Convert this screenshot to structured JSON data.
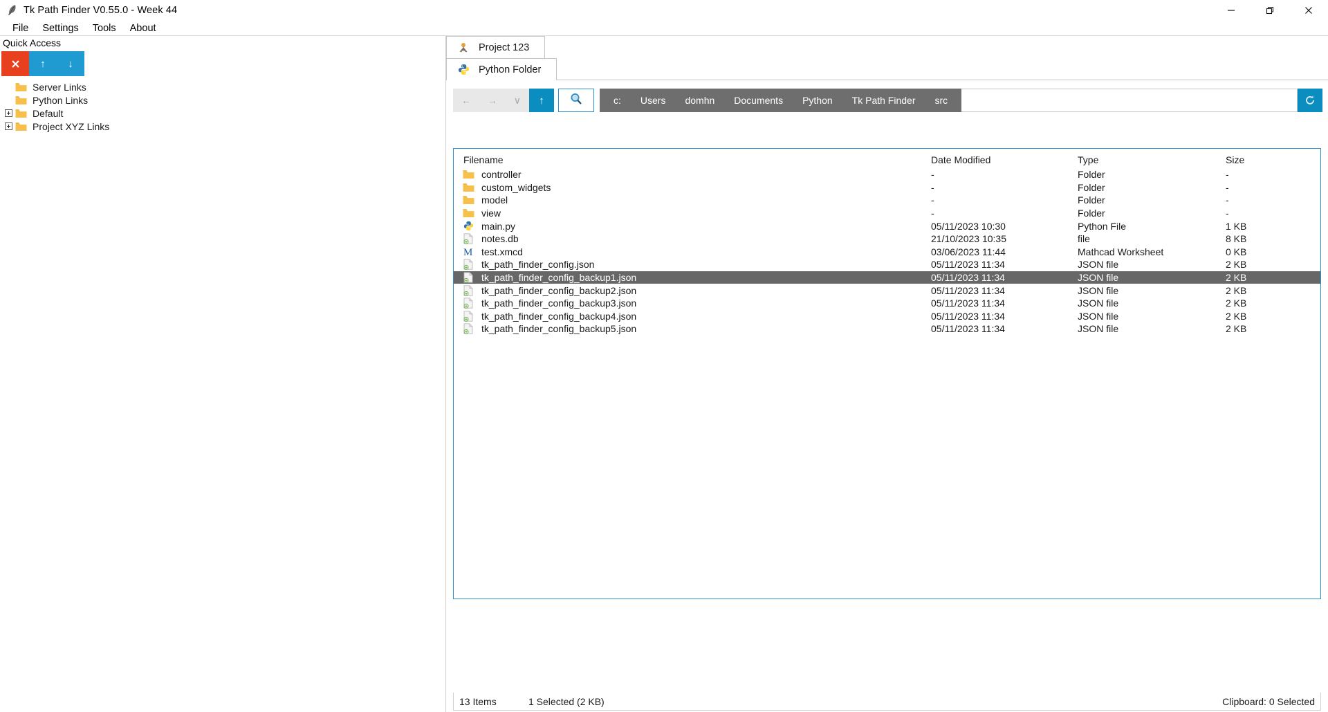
{
  "window": {
    "title": "Tk Path Finder V0.55.0 - Week 44",
    "app_icon": "feather-icon",
    "controls": {
      "minimize": "—",
      "maximize": "❐",
      "close": "✕"
    }
  },
  "menubar": {
    "items": [
      {
        "label": "File"
      },
      {
        "label": "Settings"
      },
      {
        "label": "Tools"
      },
      {
        "label": "About"
      }
    ]
  },
  "quick_access": {
    "title": "Quick Access",
    "toolbar": {
      "delete_label": "✖",
      "up_label": "↑",
      "down_label": "↓",
      "delete_color": "#e8401f",
      "move_color": "#1f9bd1"
    },
    "items": [
      {
        "label": "Server Links",
        "expandable": false
      },
      {
        "label": "Python Links",
        "expandable": false
      },
      {
        "label": "Default",
        "expandable": true
      },
      {
        "label": "Project XYZ Links",
        "expandable": true
      }
    ]
  },
  "browser": {
    "tabs_primary": [
      {
        "label": "Project 123",
        "icon": "tree-roots-icon"
      }
    ],
    "tabs_secondary": [
      {
        "label": "Python Folder",
        "icon": "python-icon"
      }
    ],
    "toolbar": {
      "back_label": "←",
      "forward_label": "→",
      "history_label": "∨",
      "up_label": "↑",
      "search_label": "search-icon",
      "refresh_label": "⟳",
      "path_value": "",
      "path_placeholder": "",
      "accent_color": "#0b8dc0",
      "crumb_bg": "#6e6e6e"
    },
    "breadcrumbs": [
      {
        "label": "c:"
      },
      {
        "label": "Users"
      },
      {
        "label": "domhn"
      },
      {
        "label": "Documents"
      },
      {
        "label": "Python"
      },
      {
        "label": "Tk Path Finder"
      },
      {
        "label": "src"
      }
    ],
    "filelist": {
      "columns": [
        {
          "key": "name",
          "label": "Filename"
        },
        {
          "key": "date",
          "label": "Date Modified"
        },
        {
          "key": "type",
          "label": "Type"
        },
        {
          "key": "size",
          "label": "Size"
        }
      ],
      "rows": [
        {
          "name": "controller",
          "date": "-",
          "type": "Folder",
          "size": "-",
          "icon": "folder-icon",
          "selected": false
        },
        {
          "name": "custom_widgets",
          "date": "-",
          "type": "Folder",
          "size": "-",
          "icon": "folder-icon",
          "selected": false
        },
        {
          "name": "model",
          "date": "-",
          "type": "Folder",
          "size": "-",
          "icon": "folder-icon",
          "selected": false
        },
        {
          "name": "view",
          "date": "-",
          "type": "Folder",
          "size": "-",
          "icon": "folder-icon",
          "selected": false
        },
        {
          "name": "main.py",
          "date": "05/11/2023  10:30",
          "type": "Python File",
          "size": "1 KB",
          "icon": "python-file-icon",
          "selected": false
        },
        {
          "name": "notes.db",
          "date": "21/10/2023  10:35",
          "type": "file",
          "size": "8 KB",
          "icon": "generic-file-icon",
          "selected": false
        },
        {
          "name": "test.xmcd",
          "date": "03/06/2023  11:44",
          "type": "Mathcad Worksheet",
          "size": "0 KB",
          "icon": "mathcad-file-icon",
          "selected": false
        },
        {
          "name": "tk_path_finder_config.json",
          "date": "05/11/2023  11:34",
          "type": "JSON file",
          "size": "2 KB",
          "icon": "generic-file-icon",
          "selected": false
        },
        {
          "name": "tk_path_finder_config_backup1.json",
          "date": "05/11/2023  11:34",
          "type": "JSON file",
          "size": "2 KB",
          "icon": "generic-file-icon",
          "selected": true
        },
        {
          "name": "tk_path_finder_config_backup2.json",
          "date": "05/11/2023  11:34",
          "type": "JSON file",
          "size": "2 KB",
          "icon": "generic-file-icon",
          "selected": false
        },
        {
          "name": "tk_path_finder_config_backup3.json",
          "date": "05/11/2023  11:34",
          "type": "JSON file",
          "size": "2 KB",
          "icon": "generic-file-icon",
          "selected": false
        },
        {
          "name": "tk_path_finder_config_backup4.json",
          "date": "05/11/2023  11:34",
          "type": "JSON file",
          "size": "2 KB",
          "icon": "generic-file-icon",
          "selected": false
        },
        {
          "name": "tk_path_finder_config_backup5.json",
          "date": "05/11/2023  11:34",
          "type": "JSON file",
          "size": "2 KB",
          "icon": "generic-file-icon",
          "selected": false
        }
      ]
    },
    "statusbar": {
      "items_count": "13 Items",
      "selection": "1 Selected  (2 KB)",
      "clipboard": "Clipboard: 0 Selected"
    }
  }
}
